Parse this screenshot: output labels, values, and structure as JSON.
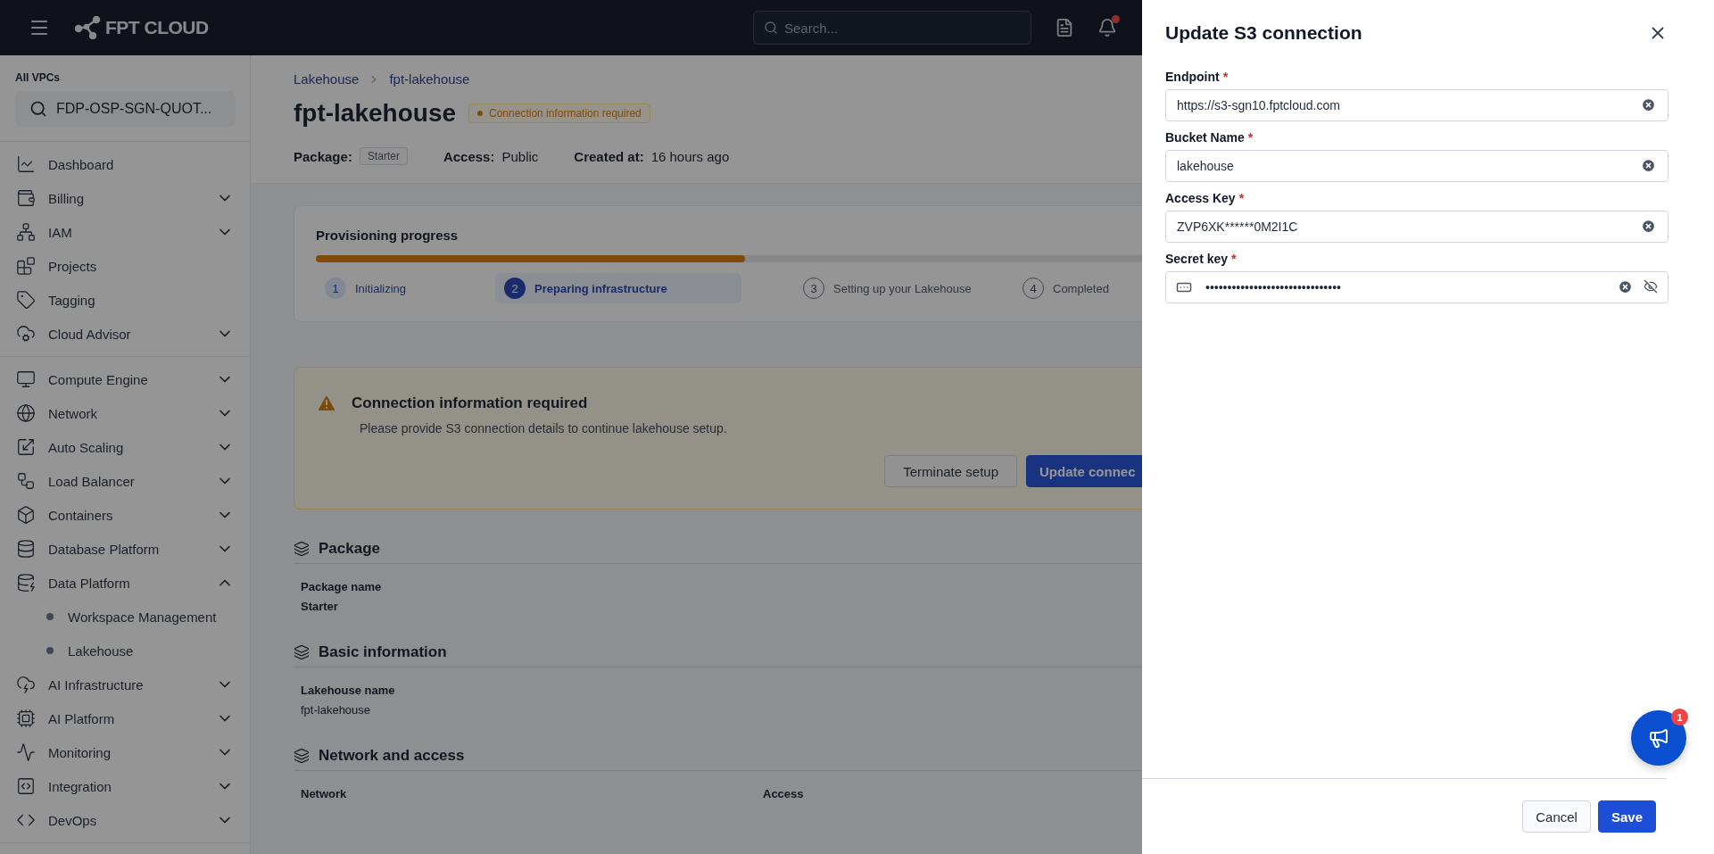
{
  "header": {
    "logo_text": "FPT CLOUD",
    "search": {
      "placeholder": "Search..."
    },
    "notifications": {
      "unread": true
    }
  },
  "sidebar": {
    "vpc_label": "All VPCs",
    "vpc_value": "FDP-OSP-SGN-QUOT...",
    "groups": [
      {
        "items": [
          {
            "label": "Dashboard",
            "expandable": false
          },
          {
            "label": "Billing",
            "expandable": true,
            "expanded": false
          },
          {
            "label": "IAM",
            "expandable": true,
            "expanded": false
          },
          {
            "label": "Projects",
            "expandable": false
          },
          {
            "label": "Tagging",
            "expandable": false
          },
          {
            "label": "Cloud Advisor",
            "expandable": true,
            "expanded": false
          }
        ]
      },
      {
        "items": [
          {
            "label": "Compute Engine",
            "expandable": true,
            "expanded": false
          },
          {
            "label": "Network",
            "expandable": true,
            "expanded": false
          },
          {
            "label": "Auto Scaling",
            "expandable": true,
            "expanded": false
          },
          {
            "label": "Load Balancer",
            "expandable": true,
            "expanded": false
          },
          {
            "label": "Containers",
            "expandable": true,
            "expanded": false
          },
          {
            "label": "Database Platform",
            "expandable": true,
            "expanded": false
          },
          {
            "label": "Data Platform",
            "expandable": true,
            "expanded": true,
            "children": [
              {
                "label": "Workspace Management"
              },
              {
                "label": "Lakehouse"
              }
            ]
          },
          {
            "label": "AI Infrastructure",
            "expandable": true,
            "expanded": false
          },
          {
            "label": "AI Platform",
            "expandable": true,
            "expanded": false
          },
          {
            "label": "Monitoring",
            "expandable": true,
            "expanded": false
          },
          {
            "label": "Integration",
            "expandable": true,
            "expanded": false
          },
          {
            "label": "DevOps",
            "expandable": true,
            "expanded": false
          }
        ]
      }
    ]
  },
  "main": {
    "breadcrumb": [
      "Lakehouse",
      "fpt-lakehouse"
    ],
    "title": "fpt-lakehouse",
    "status_badge": {
      "label": "Connection information required"
    },
    "meta": [
      {
        "label": "Package:",
        "value": "Starter",
        "kind": "tag"
      },
      {
        "label": "Access:",
        "value": "Public",
        "kind": "text"
      },
      {
        "label": "Created at:",
        "value": "16 hours ago",
        "kind": "text"
      }
    ],
    "progress": {
      "title": "Provisioning progress",
      "level": 0.49,
      "steps": [
        {
          "number": "1",
          "label": "Initializing",
          "selected": false
        },
        {
          "number": "2",
          "label": "Preparing infrastructure",
          "selected": true
        },
        {
          "number": "3",
          "label": "Setting up your Lakehouse",
          "selected": false
        },
        {
          "number": "4",
          "label": "Completed",
          "selected": false
        }
      ]
    },
    "alert": {
      "title": "Connection information required",
      "message": "Please provide S3 connection details to continue lakehouse setup.",
      "buttons": [
        {
          "label": "Terminate setup",
          "kind": "secondary"
        },
        {
          "label": "Update connec",
          "kind": "primary"
        }
      ]
    },
    "sections": [
      {
        "title": "Package",
        "fields": [
          {
            "label": "Package name",
            "value": "Starter",
            "bold": true
          }
        ]
      },
      {
        "title": "Basic information",
        "fields": [
          {
            "label": "Lakehouse name",
            "value": "fpt-lakehouse",
            "bold": false
          }
        ]
      },
      {
        "title": "Network and access",
        "fields": [
          {
            "label": "Network"
          },
          {
            "label": "Access"
          }
        ]
      }
    ]
  },
  "drawer": {
    "title": "Update S3 connection",
    "fields": [
      {
        "label": "Endpoint",
        "required_mark": "*",
        "value": "https://s3-sgn10.fptcloud.com",
        "kind": "text"
      },
      {
        "label": "Bucket Name",
        "required_mark": "*",
        "value": "lakehouse",
        "kind": "text"
      },
      {
        "label": "Access Key",
        "required_mark": "*",
        "value": "ZVP6XK******0M2I1C",
        "kind": "text"
      },
      {
        "label": "Secret key",
        "required_mark": "*",
        "value": "•••••••••••••••••••••••••••••••",
        "kind": "secret"
      }
    ],
    "buttons": [
      {
        "label": "Cancel",
        "kind": "secondary"
      },
      {
        "label": "Save",
        "kind": "primary"
      }
    ]
  },
  "fab": {
    "badge": "1"
  }
}
